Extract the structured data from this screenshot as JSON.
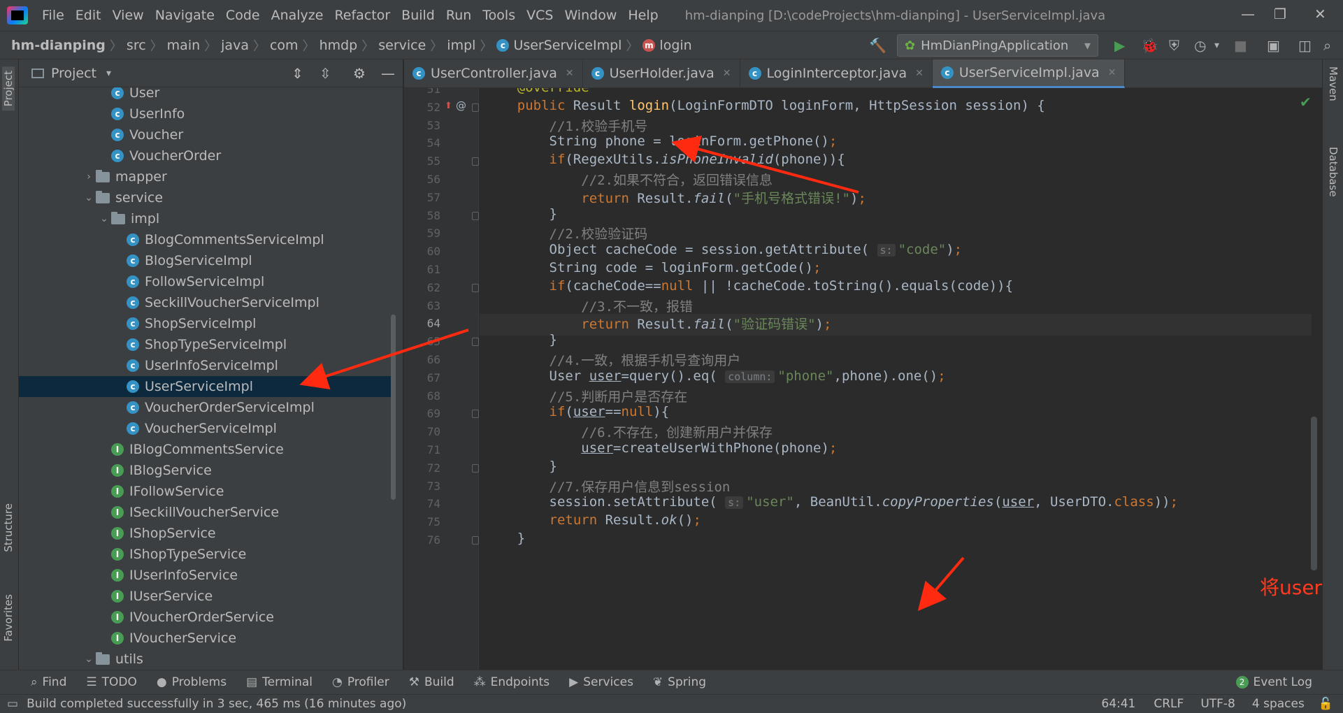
{
  "menubar": {
    "items": [
      "File",
      "Edit",
      "View",
      "Navigate",
      "Code",
      "Analyze",
      "Refactor",
      "Build",
      "Run",
      "Tools",
      "VCS",
      "Window",
      "Help"
    ],
    "window_title": "hm-dianping [D:\\codeProjects\\hm-dianping] - UserServiceImpl.java"
  },
  "breadcrumbs": [
    "hm-dianping",
    "src",
    "main",
    "java",
    "com",
    "hmdp",
    "service",
    "impl",
    "UserServiceImpl",
    "login"
  ],
  "run_config": "HmDianPingApplication",
  "project_panel": {
    "title": "Project",
    "tree": [
      {
        "label": "User",
        "kind": "class",
        "depth": 3
      },
      {
        "label": "UserInfo",
        "kind": "class",
        "depth": 3
      },
      {
        "label": "Voucher",
        "kind": "class",
        "depth": 3
      },
      {
        "label": "VoucherOrder",
        "kind": "class",
        "depth": 3
      },
      {
        "label": "mapper",
        "kind": "folder",
        "depth": 2,
        "expanded": false
      },
      {
        "label": "service",
        "kind": "folder",
        "depth": 2,
        "expanded": true
      },
      {
        "label": "impl",
        "kind": "folder",
        "depth": 3,
        "expanded": true
      },
      {
        "label": "BlogCommentsServiceImpl",
        "kind": "class",
        "depth": 4
      },
      {
        "label": "BlogServiceImpl",
        "kind": "class",
        "depth": 4
      },
      {
        "label": "FollowServiceImpl",
        "kind": "class",
        "depth": 4
      },
      {
        "label": "SeckillVoucherServiceImpl",
        "kind": "class",
        "depth": 4
      },
      {
        "label": "ShopServiceImpl",
        "kind": "class",
        "depth": 4
      },
      {
        "label": "ShopTypeServiceImpl",
        "kind": "class",
        "depth": 4
      },
      {
        "label": "UserInfoServiceImpl",
        "kind": "class",
        "depth": 4
      },
      {
        "label": "UserServiceImpl",
        "kind": "class",
        "depth": 4,
        "selected": true
      },
      {
        "label": "VoucherOrderServiceImpl",
        "kind": "class",
        "depth": 4
      },
      {
        "label": "VoucherServiceImpl",
        "kind": "class",
        "depth": 4
      },
      {
        "label": "IBlogCommentsService",
        "kind": "interface",
        "depth": 3
      },
      {
        "label": "IBlogService",
        "kind": "interface",
        "depth": 3
      },
      {
        "label": "IFollowService",
        "kind": "interface",
        "depth": 3
      },
      {
        "label": "ISeckillVoucherService",
        "kind": "interface",
        "depth": 3
      },
      {
        "label": "IShopService",
        "kind": "interface",
        "depth": 3
      },
      {
        "label": "IShopTypeService",
        "kind": "interface",
        "depth": 3
      },
      {
        "label": "IUserInfoService",
        "kind": "interface",
        "depth": 3
      },
      {
        "label": "IUserService",
        "kind": "interface",
        "depth": 3
      },
      {
        "label": "IVoucherOrderService",
        "kind": "interface",
        "depth": 3
      },
      {
        "label": "IVoucherService",
        "kind": "interface",
        "depth": 3
      },
      {
        "label": "utils",
        "kind": "folder",
        "depth": 2,
        "expanded": true
      }
    ]
  },
  "editor_tabs": [
    {
      "label": "UserController.java",
      "active": false
    },
    {
      "label": "UserHolder.java",
      "active": false
    },
    {
      "label": "LoginInterceptor.java",
      "active": false
    },
    {
      "label": "UserServiceImpl.java",
      "active": true
    }
  ],
  "code_lines": [
    {
      "n": 51,
      "html": "    <span class=\"ann\">@Override</span>"
    },
    {
      "n": 52,
      "html": "    <span class=\"kw\">public</span> Result <span class=\"fn\">login</span>(LoginFormDTO loginForm, HttpSession session) {"
    },
    {
      "n": 53,
      "html": "        <span class=\"cm\">//1.校验手机号</span>"
    },
    {
      "n": 54,
      "html": "        String phone = loginForm.getPhone()<span class=\"kw\">;</span>"
    },
    {
      "n": 55,
      "html": "        <span class=\"kw\">if</span>(RegexUtils.<span class=\"it\">isPhoneInvalid</span>(phone)){"
    },
    {
      "n": 56,
      "html": "            <span class=\"cm\">//2.如果不符合，返回错误信息</span>"
    },
    {
      "n": 57,
      "html": "            <span class=\"kw\">return</span> Result.<span class=\"it\">fail</span>(<span class=\"str\">\"手机号格式错误!\"</span>)<span class=\"kw\">;</span>"
    },
    {
      "n": 58,
      "html": "        }"
    },
    {
      "n": 59,
      "html": "        <span class=\"cm\">//2.校验验证码</span>"
    },
    {
      "n": 60,
      "html": "        Object cacheCode = session.getAttribute( <span class=\"hint\">s:</span><span class=\"str\">\"code\"</span>)<span class=\"kw\">;</span>"
    },
    {
      "n": 61,
      "html": "        String code = loginForm.getCode()<span class=\"kw\">;</span>"
    },
    {
      "n": 62,
      "html": "        <span class=\"kw\">if</span>(cacheCode==<span class=\"kw\">null</span> || !cacheCode.toString().equals(code)){"
    },
    {
      "n": 63,
      "html": "            <span class=\"cm\">//3.不一致，报错</span>"
    },
    {
      "n": 64,
      "html": "            <span class=\"kw\">return</span> Result.<span class=\"it\">fail</span>(<span class=\"str\">\"验证码错误\"</span>)<span class=\"kw\">;</span>"
    },
    {
      "n": 65,
      "html": "        }"
    },
    {
      "n": 66,
      "html": "        <span class=\"cm\">//4.一致，根据手机号查询用户</span>"
    },
    {
      "n": 67,
      "html": "        User <span class=\"ul\">user</span>=query().eq( <span class=\"hint\">column:</span><span class=\"str\">\"phone\"</span>,phone).one()<span class=\"kw\">;</span>"
    },
    {
      "n": 68,
      "html": "        <span class=\"cm\">//5.判断用户是否存在</span>"
    },
    {
      "n": 69,
      "html": "        <span class=\"kw\">if</span>(<span class=\"ul\">user</span>==<span class=\"kw\">null</span>){"
    },
    {
      "n": 70,
      "html": "            <span class=\"cm\">//6.不存在，创建新用户并保存</span>"
    },
    {
      "n": 71,
      "html": "            <span class=\"ul\">user</span>=createUserWithPhone(phone)<span class=\"kw\">;</span>"
    },
    {
      "n": 72,
      "html": "        }"
    },
    {
      "n": 73,
      "html": "        <span class=\"cm\">//7.保存用户信息到session</span>"
    },
    {
      "n": 74,
      "html": "        session.setAttribute( <span class=\"hint\">s:</span><span class=\"str\">\"user\"</span>, BeanUtil.<span class=\"it\">copyProperties</span>(<span class=\"ul\">user</span>, UserDTO.<span class=\"kw\">class</span>))<span class=\"kw\">;</span>"
    },
    {
      "n": 75,
      "html": "        <span class=\"kw\">return</span> Result.<span class=\"it\">ok</span>()<span class=\"kw\">;</span>"
    },
    {
      "n": 76,
      "html": "    }"
    }
  ],
  "current_line": 64,
  "annotation_text": "将user对象的字段复制到新创建的UserDTO对象中",
  "tool_windows": [
    "Find",
    "TODO",
    "Problems",
    "Terminal",
    "Profiler",
    "Build",
    "Endpoints",
    "Services",
    "Spring"
  ],
  "event_log": {
    "badge": "2",
    "label": "Event Log"
  },
  "status": {
    "message": "Build completed successfully in 3 sec, 465 ms (16 minutes ago)",
    "position": "64:41",
    "line_sep": "CRLF",
    "encoding": "UTF-8",
    "indent": "4 spaces"
  },
  "side_tabs": {
    "left": [
      "Project",
      "Structure",
      "Favorites"
    ],
    "right": [
      "Maven",
      "Database"
    ]
  },
  "colors": {
    "accent": "#4a88c7",
    "annotation": "#ff3b1f",
    "selection": "#0d293e"
  }
}
